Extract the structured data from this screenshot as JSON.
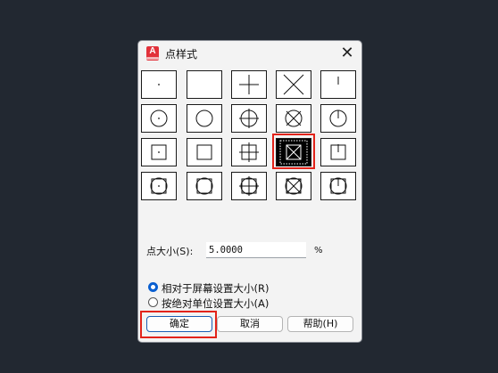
{
  "dialog": {
    "title": "点样式",
    "app_icon_letter": "A",
    "close_symbol": "✕"
  },
  "point_styles": {
    "rows": [
      [
        "dot",
        "none",
        "plus",
        "x",
        "tick"
      ],
      [
        "circle-dot",
        "circle",
        "circle-plus",
        "circle-x",
        "circle-tick"
      ],
      [
        "square-dot",
        "square",
        "square-plus",
        "square-x",
        "square-tick"
      ],
      [
        "circle-square-dot",
        "circle-square",
        "circle-square-plus",
        "circle-square-x",
        "circle-square-tick"
      ]
    ],
    "selected": "square-x"
  },
  "point_size": {
    "label": "点大小(S):",
    "value": "5.0000",
    "unit": "%"
  },
  "size_mode": {
    "options": [
      {
        "label": "相对于屏幕设置大小(R)",
        "selected": true
      },
      {
        "label": "按绝对单位设置大小(A)",
        "selected": false
      }
    ]
  },
  "buttons": {
    "ok": "确定",
    "cancel": "取消",
    "help": "帮助(H)"
  },
  "colors": {
    "accent": "#0a5fd0",
    "highlight": "#e2231a",
    "app_icon": "#e2313a"
  }
}
